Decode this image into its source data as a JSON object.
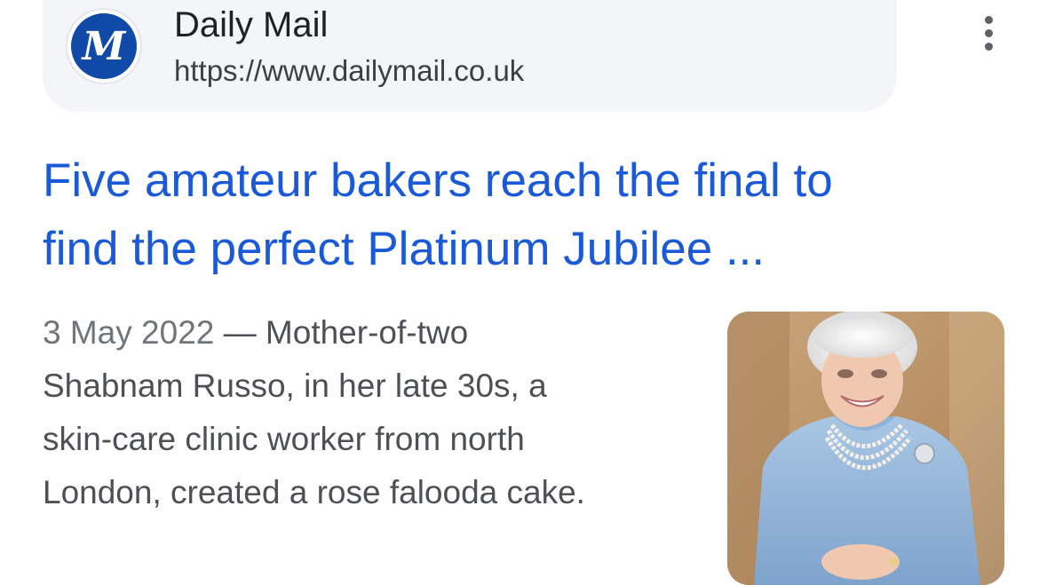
{
  "result": {
    "source": {
      "favicon_icon": "daily-mail-logo-icon",
      "favicon_letter": "M",
      "name": "Daily Mail",
      "url": "https://www.dailymail.co.uk",
      "more_icon": "more-vert-icon"
    },
    "title": {
      "line1": "Five amateur bakers reach the final to",
      "line2": "find the perfect Platinum Jubilee ..."
    },
    "snippet": {
      "date": "3 May 2022",
      "separator": " — ",
      "line1_rest": "Mother-of-two",
      "line2": "Shabnam Russo, in her late 30s, a",
      "line3": "skin-care clinic worker from north",
      "line4": "London, created a rose falooda cake."
    },
    "thumbnail": {
      "icon": "woman-in-blue-dress-photo"
    }
  },
  "colors": {
    "link": "#1a5ad8",
    "pill_background": "#f4f5f8",
    "favicon_blue": "#0f4aa8",
    "snippet_text": "#4d5156"
  }
}
